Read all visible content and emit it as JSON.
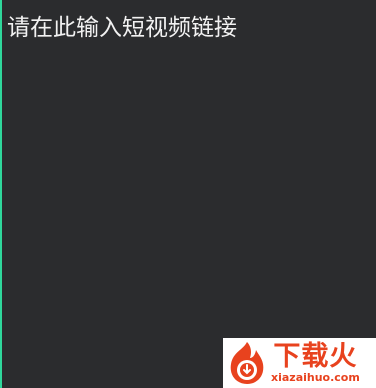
{
  "input": {
    "placeholder": "请在此输入短视频链接",
    "value": ""
  },
  "watermark": {
    "brand_cn": "下载火",
    "brand_en": "xiazaihuo.com",
    "logo_icon": "flame-logo-icon",
    "color": "#e8421e"
  },
  "colors": {
    "background": "#2b2c2e",
    "accent_border": "#2fd79b",
    "text": "#f2f2f2"
  }
}
